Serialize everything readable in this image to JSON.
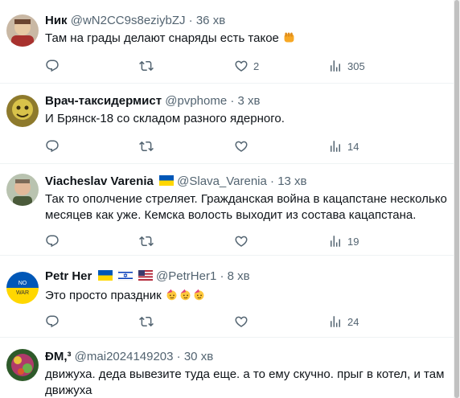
{
  "tweets": [
    {
      "name": "Ник",
      "handle": "@wN2CC9s8eziybZJ",
      "sep": "·",
      "time": "36 хв",
      "text": "Там на грады делают снаряды есть такое",
      "replies": "",
      "likes": "2",
      "views": "305"
    },
    {
      "name": "Врач-таксидермист",
      "handle": "@pvphome",
      "sep": "·",
      "time": "3 хв",
      "text": "И Брянск-18 со складом разного ядерного.",
      "replies": "",
      "likes": "",
      "views": "14"
    },
    {
      "name": "Viacheslav Varenia",
      "handle": "@Slava_Varenia",
      "sep": "·",
      "time": "13 хв",
      "text": "Так то ополчение стреляет. Гражданская война в кацапстане несколько месяцев как уже. Кемска волость выходит из состава кацапстана.",
      "replies": "",
      "likes": "",
      "views": "19"
    },
    {
      "name": "Petr Her",
      "handle": "@PetrHer1",
      "sep": "·",
      "time": "8 хв",
      "text": "Это просто праздник",
      "avatar_text": [
        "NO",
        "WAR"
      ],
      "replies": "",
      "likes": "",
      "views": "24"
    },
    {
      "name": "ÐM,³",
      "handle": "@mai2024149203",
      "sep": "·",
      "time": "30 хв",
      "text": "движуха. деда вывезите туда еще. а то ему скучно. прыг в котел, и там движуха"
    }
  ],
  "icons": {
    "reply": "reply-icon",
    "retweet": "retweet-icon",
    "like": "heart-icon",
    "views": "views-chart-icon"
  },
  "colors": {
    "text": "#0f1419",
    "secondary": "#536471",
    "divider": "#eff3f4",
    "ukraine_blue": "#0057b7",
    "ukraine_yellow": "#ffd700"
  }
}
